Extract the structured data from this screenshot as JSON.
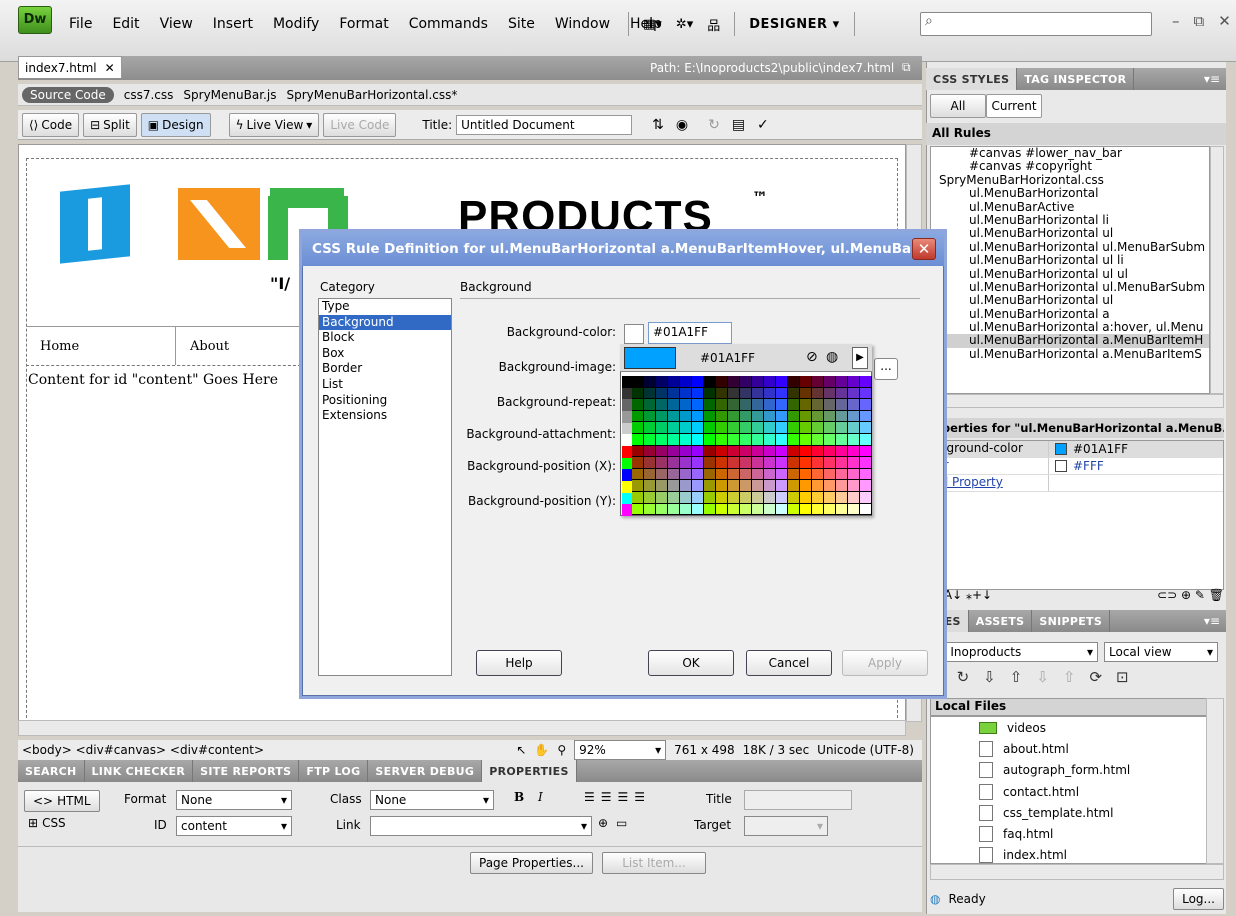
{
  "app": {
    "logo": "Dw",
    "menu": [
      "File",
      "Edit",
      "View",
      "Insert",
      "Modify",
      "Format",
      "Commands",
      "Site",
      "Window",
      "Help"
    ],
    "workspace": "DESIGNER ▾",
    "search_icon": "⌕"
  },
  "document": {
    "tab": "index7.html",
    "path": "Path:  E:\\Inoproducts2\\public\\index7.html",
    "source_code": "Source Code",
    "related_files": [
      "css7.css",
      "SpryMenuBar.js",
      "SpryMenuBarHorizontal.css*"
    ],
    "modes": {
      "code": "Code",
      "split": "Split",
      "design": "Design",
      "live_view": "Live View",
      "live_code": "Live Code"
    },
    "title_label": "Title:",
    "title_value": "Untitled Document"
  },
  "page": {
    "brand": "PRODUCTS",
    "trademark": "™",
    "tagline": "\"I/",
    "nav": [
      "Home",
      "About"
    ],
    "content": "Content for id \"content\" Goes Here"
  },
  "status": {
    "tags": "<body> <div#canvas> <div#content>",
    "zoom": "92%",
    "size": "761 x 498",
    "download": "18K / 3 sec",
    "encoding": "Unicode (UTF-8)"
  },
  "bottom_tabs": [
    "SEARCH",
    "LINK CHECKER",
    "SITE REPORTS",
    "FTP LOG",
    "SERVER DEBUG",
    "PROPERTIES"
  ],
  "properties": {
    "html_btn": "HTML",
    "css_btn": "CSS",
    "format_label": "Format",
    "format_value": "None",
    "class_label": "Class",
    "class_value": "None",
    "id_label": "ID",
    "id_value": "content",
    "link_label": "Link",
    "link_value": "",
    "title_label": "Title",
    "target_label": "Target",
    "page_props": "Page Properties...",
    "list_item": "List Item..."
  },
  "css_panel": {
    "tabs": [
      "CSS STYLES",
      "TAG INSPECTOR"
    ],
    "all": "All",
    "current": "Current",
    "all_rules": "All Rules",
    "rules": [
      {
        "t": "#canvas #lower_nav_bar",
        "indent": 2
      },
      {
        "t": "#canvas #copyright",
        "indent": 2
      },
      {
        "t": "SpryMenuBarHorizontal.css",
        "indent": 0
      },
      {
        "t": "ul.MenuBarHorizontal",
        "indent": 2
      },
      {
        "t": "ul.MenuBarActive",
        "indent": 2
      },
      {
        "t": "ul.MenuBarHorizontal li",
        "indent": 2
      },
      {
        "t": "ul.MenuBarHorizontal ul",
        "indent": 2
      },
      {
        "t": "ul.MenuBarHorizontal ul.MenuBarSubm",
        "indent": 2
      },
      {
        "t": "ul.MenuBarHorizontal ul li",
        "indent": 2
      },
      {
        "t": "ul.MenuBarHorizontal ul ul",
        "indent": 2
      },
      {
        "t": "ul.MenuBarHorizontal ul.MenuBarSubm",
        "indent": 2
      },
      {
        "t": "ul.MenuBarHorizontal ul",
        "indent": 2
      },
      {
        "t": "ul.MenuBarHorizontal a",
        "indent": 2
      },
      {
        "t": "ul.MenuBarHorizontal a:hover, ul.Menu",
        "indent": 2
      },
      {
        "t": "ul.MenuBarHorizontal a.MenuBarItemH",
        "indent": 2,
        "selected": true
      },
      {
        "t": "ul.MenuBarHorizontal a.MenuBarItemS",
        "indent": 2
      }
    ],
    "props_header": "operties for \"ul.MenuBarHorizontal a.MenuB...",
    "props": [
      {
        "k": "ckground-color",
        "v": "#01A1FF",
        "color": "#01A1FF"
      },
      {
        "k": "lor",
        "v": "#FFF",
        "color": "#FFFFFF"
      }
    ],
    "add_property": "dd Property"
  },
  "files_panel": {
    "tabs": [
      "ILES",
      "ASSETS",
      "SNIPPETS"
    ],
    "site": "Inoproducts",
    "view": "Local view",
    "local_files": "Local Files",
    "items": [
      {
        "name": "videos",
        "folder": true
      },
      {
        "name": "about.html"
      },
      {
        "name": "autograph_form.html"
      },
      {
        "name": "contact.html"
      },
      {
        "name": "css_template.html"
      },
      {
        "name": "faq.html"
      },
      {
        "name": "index.html"
      }
    ],
    "ready": "Ready",
    "log": "Log..."
  },
  "dialog": {
    "title": "CSS Rule Definition for ul.MenuBarHorizontal a.MenuBarItemHover, ul.MenuBa...",
    "category_label": "Category",
    "categories": [
      "Type",
      "Background",
      "Block",
      "Box",
      "Border",
      "List",
      "Positioning",
      "Extensions"
    ],
    "section": "Background",
    "fields": [
      "Background-color:",
      "Background-image:",
      "Background-repeat:",
      "Background-attachment:",
      "Background-position (X):",
      "Background-position (Y):"
    ],
    "bg_color": "#01A1FF",
    "picker_hex": "#01A1FF",
    "help": "Help",
    "ok": "OK",
    "cancel": "Cancel",
    "apply": "Apply"
  },
  "colors": {
    "accent": "#01A1FF",
    "logo_blue": "#1a9be0",
    "logo_orange": "#f7941d",
    "logo_green": "#3ab54a"
  }
}
